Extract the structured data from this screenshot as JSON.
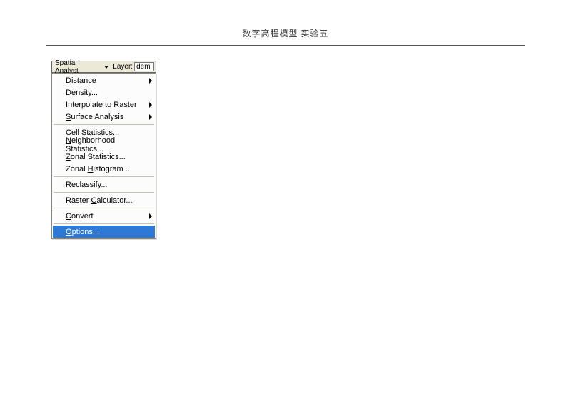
{
  "header": {
    "title": "数字高程模型  实验五"
  },
  "toolbar": {
    "button_label": "Spatial Analyst",
    "button_underline_char": "A",
    "layer_label": "Layer:",
    "layer_value": "dem"
  },
  "menu": {
    "items": [
      {
        "label": "Distance",
        "u": 0,
        "submenu": true
      },
      {
        "label": "Density...",
        "u": 1
      },
      {
        "label": "Interpolate to Raster",
        "u": 0,
        "submenu": true
      },
      {
        "label": "Surface Analysis",
        "u": 0,
        "submenu": true
      },
      {
        "sep": true
      },
      {
        "label": "Cell Statistics...",
        "u": 1
      },
      {
        "label": "Neighborhood Statistics...",
        "u": 0
      },
      {
        "label": "Zonal Statistics...",
        "u": 0
      },
      {
        "label": "Zonal Histogram ...",
        "u": 6
      },
      {
        "sep": true
      },
      {
        "label": "Reclassify...",
        "u": 0
      },
      {
        "sep": true
      },
      {
        "label": "Raster Calculator...",
        "u": 7
      },
      {
        "sep": true
      },
      {
        "label": "Convert",
        "u": 0,
        "submenu": true
      },
      {
        "sep": true
      },
      {
        "label": "Options...",
        "u": 0,
        "highlight": true
      }
    ]
  }
}
